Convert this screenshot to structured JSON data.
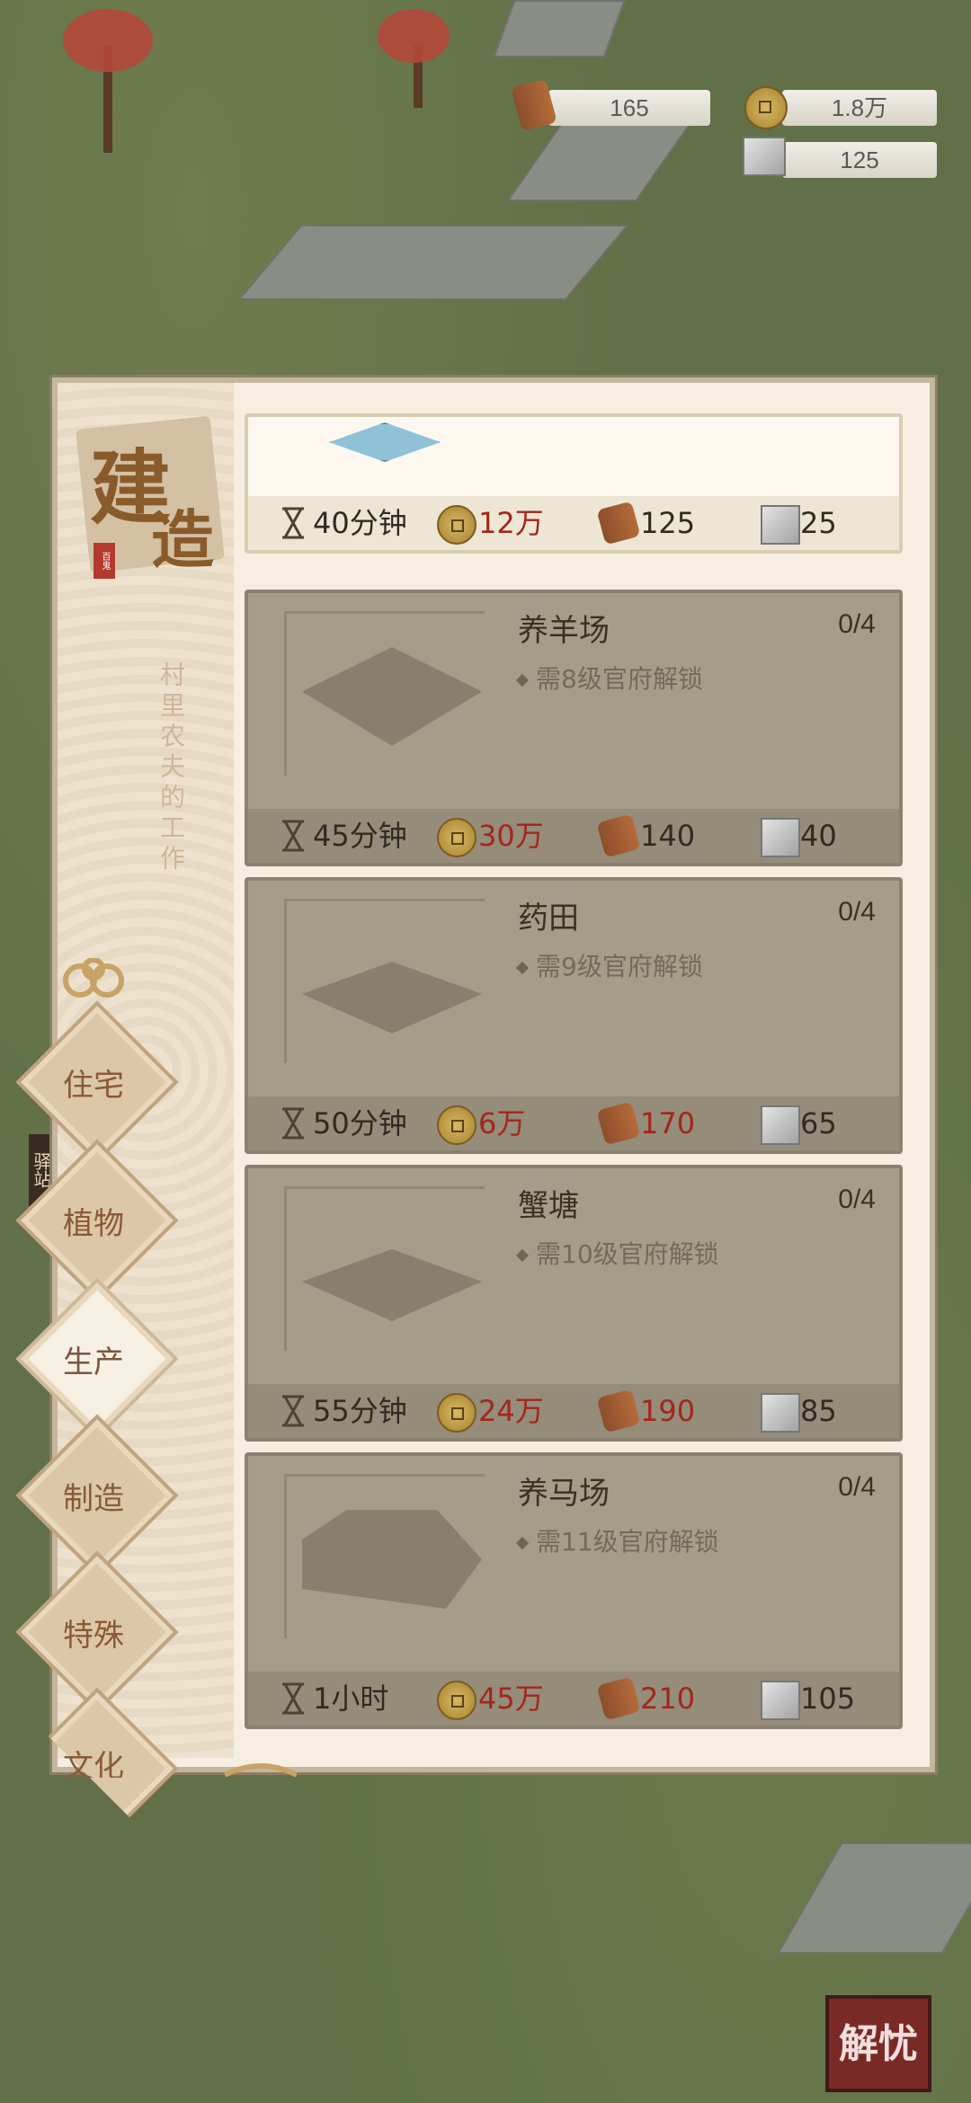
{
  "resources": {
    "wood": "165",
    "coins": "1.8万",
    "stone": "125"
  },
  "panel": {
    "title": "建造",
    "title_char1": "建",
    "title_char2": "造",
    "seal": "百鬼",
    "description": "村里农夫的工作"
  },
  "tabs": [
    {
      "label": "住宅",
      "active": false
    },
    {
      "label": "植物",
      "active": false
    },
    {
      "label": "生产",
      "active": true
    },
    {
      "label": "制造",
      "active": false
    },
    {
      "label": "特殊",
      "active": false
    },
    {
      "label": "文化",
      "active": false
    }
  ],
  "buildings": [
    {
      "name": "",
      "count": "",
      "requirement": "",
      "time": "40分钟",
      "coins": "12万",
      "wood": "125",
      "stone": "25",
      "unlocked": true
    },
    {
      "name": "养羊场",
      "count": "0/4",
      "requirement": "需8级官府解锁",
      "time": "45分钟",
      "coins": "30万",
      "wood": "140",
      "stone": "40",
      "unlocked": false
    },
    {
      "name": "药田",
      "count": "0/4",
      "requirement": "需9级官府解锁",
      "time": "50分钟",
      "coins": "6万",
      "wood": "170",
      "stone": "65",
      "unlocked": false
    },
    {
      "name": "蟹塘",
      "count": "0/4",
      "requirement": "需10级官府解锁",
      "time": "55分钟",
      "coins": "24万",
      "wood": "190",
      "stone": "85",
      "unlocked": false
    },
    {
      "name": "养马场",
      "count": "0/4",
      "requirement": "需11级官府解锁",
      "time": "1小时",
      "coins": "45万",
      "wood": "210",
      "stone": "105",
      "unlocked": false
    }
  ],
  "map_labels": {
    "station": "驿站",
    "resolve_button": "解忧"
  },
  "colors": {
    "red_cost": "#a3261c",
    "panel_bg": "#f5eee1",
    "locked_card": "#a59c8a"
  }
}
